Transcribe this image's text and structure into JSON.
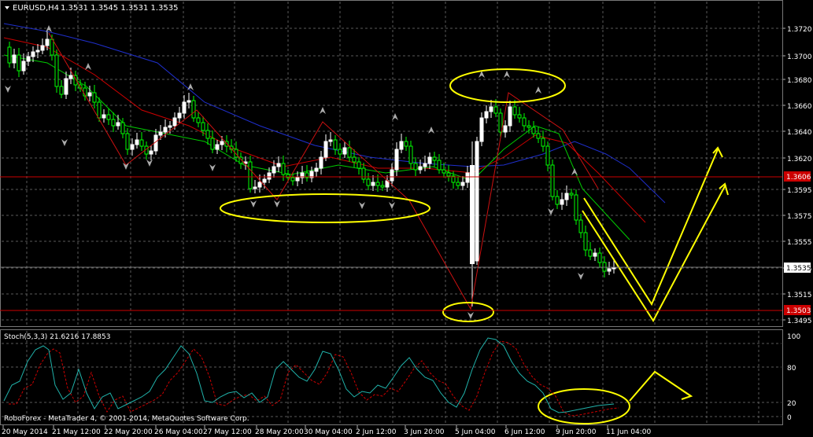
{
  "header": {
    "symbol_label": "EURUSD,H4",
    "ohlc": "1.3531 1.3545 1.3531 1.3535"
  },
  "price_axis": {
    "ticks": [
      "1.3720",
      "1.3700",
      "1.3680",
      "1.3660",
      "1.3640",
      "1.3620",
      "1.3595",
      "1.3575",
      "1.3555",
      "1.3535",
      "1.3515",
      "1.3495"
    ],
    "marker_upper": "1.3606",
    "marker_lower": "1.3503",
    "current": "1.3535"
  },
  "indicator": {
    "label": "Stoch(5,3,3) 21.6216 17.8853",
    "ticks": [
      "100",
      "80",
      "20",
      "0"
    ]
  },
  "footer": {
    "copyright": "RoboForex - MetaTrader 4, © 2001-2014, MetaQuotes Software Corp."
  },
  "time_axis": [
    "20 May 2014",
    "21 May 12:00",
    "22 May 20:00",
    "26 May 04:00",
    "27 May 12:00",
    "28 May 20:00",
    "30 May 04:00",
    "2 Jun 12:00",
    "3 Jun 20:00",
    "5 Jun 04:00",
    "6 Jun 12:00",
    "9 Jun 20:00",
    "11 Jun 04:00"
  ],
  "colors": {
    "background": "#000000",
    "grid": "#5a5a5a",
    "bull_candle": "#ffffff",
    "bear_candle": "#00ff00",
    "ma_fast": "#00cc00",
    "ma_mid": "#cc0000",
    "ma_slow": "#1f2fcc",
    "zigzag": "#cc1111",
    "stoch_main": "#20b2aa",
    "stoch_signal": "#cc0000",
    "annotation": "#ffff00",
    "level_line": "#cc0000"
  }
}
